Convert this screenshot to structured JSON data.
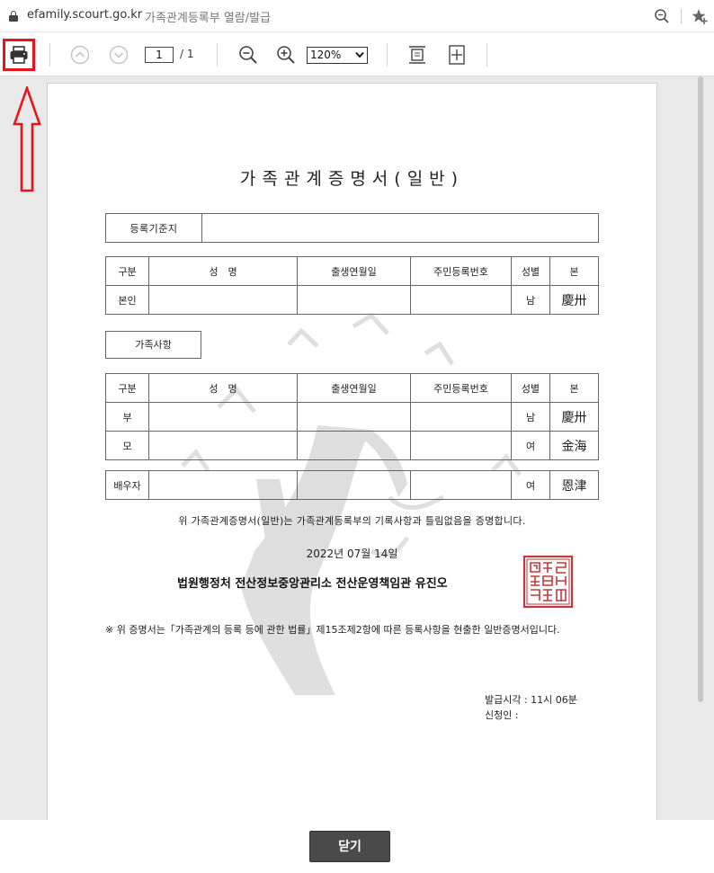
{
  "address_bar": {
    "url": "efamily.scourt.go.kr",
    "page_title": "가족관계등록부 열람/발급"
  },
  "toolbar": {
    "page_current": "1",
    "page_total": "/ 1",
    "zoom_value": "120%"
  },
  "document": {
    "title": "가족관계증명서(일반)",
    "registration_label": "등록기준지",
    "registration_value": "",
    "family_section_label": "가족사항",
    "columns": {
      "category": "구분",
      "name": "성　명",
      "birth": "출생연월일",
      "id_number": "주민등록번호",
      "gender": "성별",
      "origin": "본"
    },
    "self_row": {
      "category": "본인",
      "name": "",
      "birth": "",
      "id_number": "",
      "gender": "남",
      "origin": "慶卅"
    },
    "family_rows": [
      {
        "category": "부",
        "name": "",
        "birth": "",
        "id_number": "",
        "gender": "남",
        "origin": "慶卅"
      },
      {
        "category": "모",
        "name": "",
        "birth": "",
        "id_number": "",
        "gender": "여",
        "origin": "金海"
      }
    ],
    "spouse_row": {
      "category": "배우자",
      "name": "",
      "birth": "",
      "id_number": "",
      "gender": "여",
      "origin": "恩津"
    },
    "certification_text": "위 가족관계증명서(일반)는 가족관계등록부의 기록사항과 틀림없음을 증명합니다.",
    "issue_date": "2022년 07월 14일",
    "issuer": "법원행정처 전산정보중앙관리소 전산운영책임관 유진오",
    "note": "※ 위 증명서는「가족관계의 등록 등에 관한 법률」제15조제2항에 따른 등록사항을 현출한 일반증명서입니다.",
    "issue_time_label": "발급시각 : 11시 06분",
    "applicant_label": "신청인 :"
  },
  "footer": {
    "close_label": "닫기"
  },
  "colors": {
    "annotation_red": "#e8141c",
    "seal_red": "#c0393b",
    "close_button_bg": "#4a4a4a",
    "viewer_bg": "#e9e9e9"
  }
}
